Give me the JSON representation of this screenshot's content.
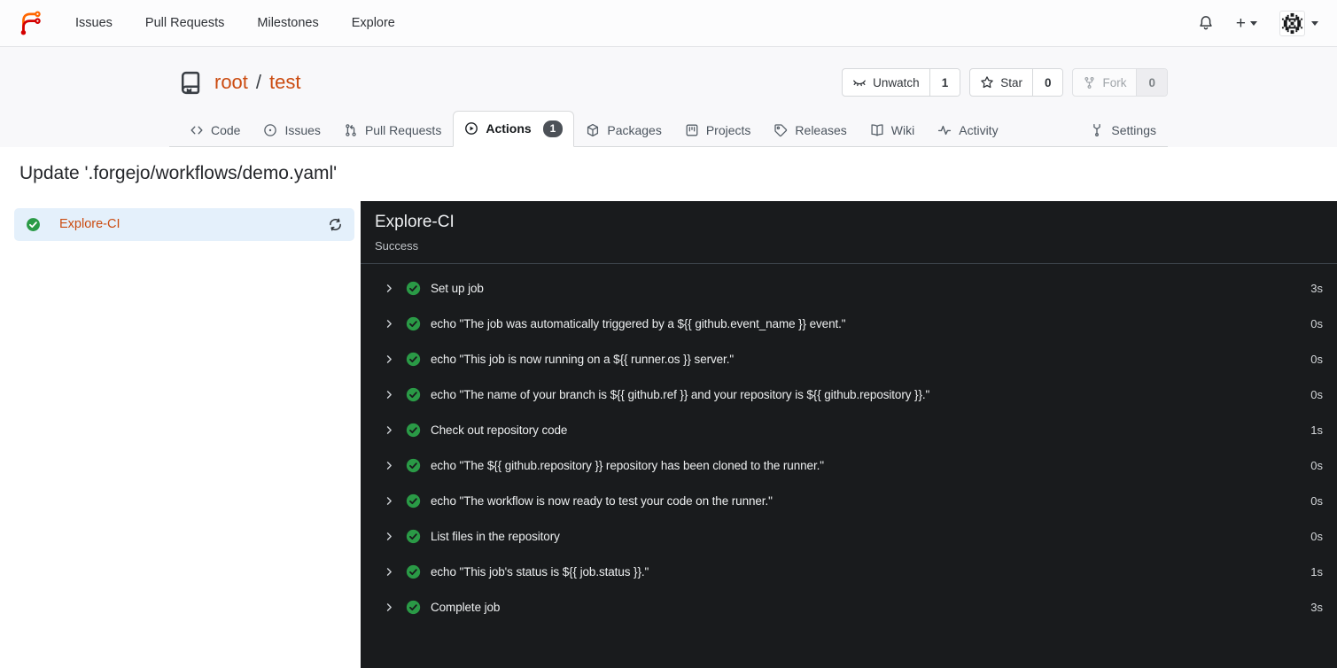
{
  "colors": {
    "primary": "#cb4b10",
    "success_green": "#2a9a46",
    "panel_background": "#191b1d",
    "selected_item_background": "#e4f0fb",
    "badge_background": "#4c5157"
  },
  "navbar": {
    "items": [
      {
        "label": "Issues"
      },
      {
        "label": "Pull Requests"
      },
      {
        "label": "Milestones"
      },
      {
        "label": "Explore"
      }
    ]
  },
  "repo": {
    "owner": "root",
    "separator": "/",
    "name": "test",
    "actions": [
      {
        "label": "Unwatch",
        "count": "1"
      },
      {
        "label": "Star",
        "count": "0"
      },
      {
        "label": "Fork",
        "count": "0"
      }
    ]
  },
  "tabs": [
    {
      "label": "Code"
    },
    {
      "label": "Issues"
    },
    {
      "label": "Pull Requests"
    },
    {
      "label": "Actions",
      "badge": "1",
      "active": true
    },
    {
      "label": "Packages"
    },
    {
      "label": "Projects"
    },
    {
      "label": "Releases"
    },
    {
      "label": "Wiki"
    },
    {
      "label": "Activity"
    },
    {
      "label": "Settings"
    }
  ],
  "run": {
    "title": "Update '.forgejo/workflows/demo.yaml'",
    "job_name": "Explore-CI",
    "panel_title": "Explore-CI",
    "panel_status": "Success",
    "steps": [
      {
        "label": "Set up job",
        "duration": "3s"
      },
      {
        "label": "echo \"The job was automatically triggered by a ${{ github.event_name }} event.\"",
        "duration": "0s"
      },
      {
        "label": "echo \"This job is now running on a ${{ runner.os }} server.\"",
        "duration": "0s"
      },
      {
        "label": "echo \"The name of your branch is ${{ github.ref }} and your repository is ${{ github.repository }}.\"",
        "duration": "0s"
      },
      {
        "label": "Check out repository code",
        "duration": "1s"
      },
      {
        "label": "echo \"The ${{ github.repository }} repository has been cloned to the runner.\"",
        "duration": "0s"
      },
      {
        "label": "echo \"The workflow is now ready to test your code on the runner.\"",
        "duration": "0s"
      },
      {
        "label": "List files in the repository",
        "duration": "0s"
      },
      {
        "label": "echo \"This job's status is ${{ job.status }}.\"",
        "duration": "1s"
      },
      {
        "label": "Complete job",
        "duration": "3s"
      }
    ]
  }
}
